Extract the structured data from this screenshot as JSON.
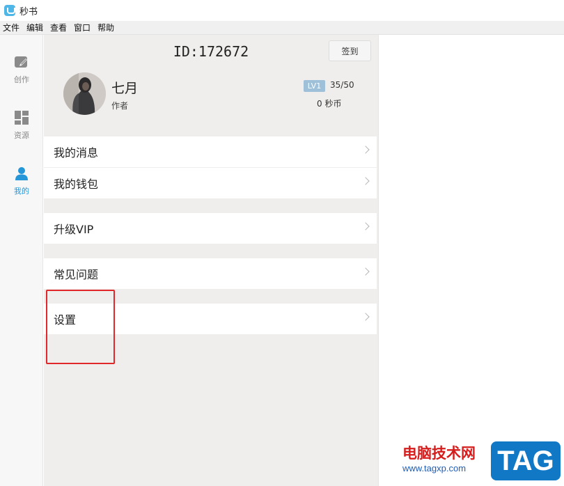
{
  "app": {
    "title": "秒书"
  },
  "menu": [
    "文件",
    "编辑",
    "查看",
    "窗口",
    "帮助"
  ],
  "rail": [
    {
      "label": "创作",
      "icon": "edit-icon",
      "active": false
    },
    {
      "label": "资源",
      "icon": "grid-icon",
      "active": false
    },
    {
      "label": "我的",
      "icon": "user-icon",
      "active": true
    }
  ],
  "profile": {
    "id_text": "ID:172672",
    "signin_label": "签到",
    "name": "七月",
    "role": "作者",
    "level": "LV1",
    "progress": "35/50",
    "coins": "0 秒币"
  },
  "list": [
    "我的消息",
    "我的钱包",
    "升级VIP",
    "常见问题",
    "设置"
  ],
  "watermark": {
    "site": "电脑技术网",
    "url": "www.tagxp.com",
    "tag": "TAG"
  },
  "colors": {
    "accent": "#2596d8",
    "highlight": "#e0282b",
    "badge": "#9fc0d9"
  }
}
